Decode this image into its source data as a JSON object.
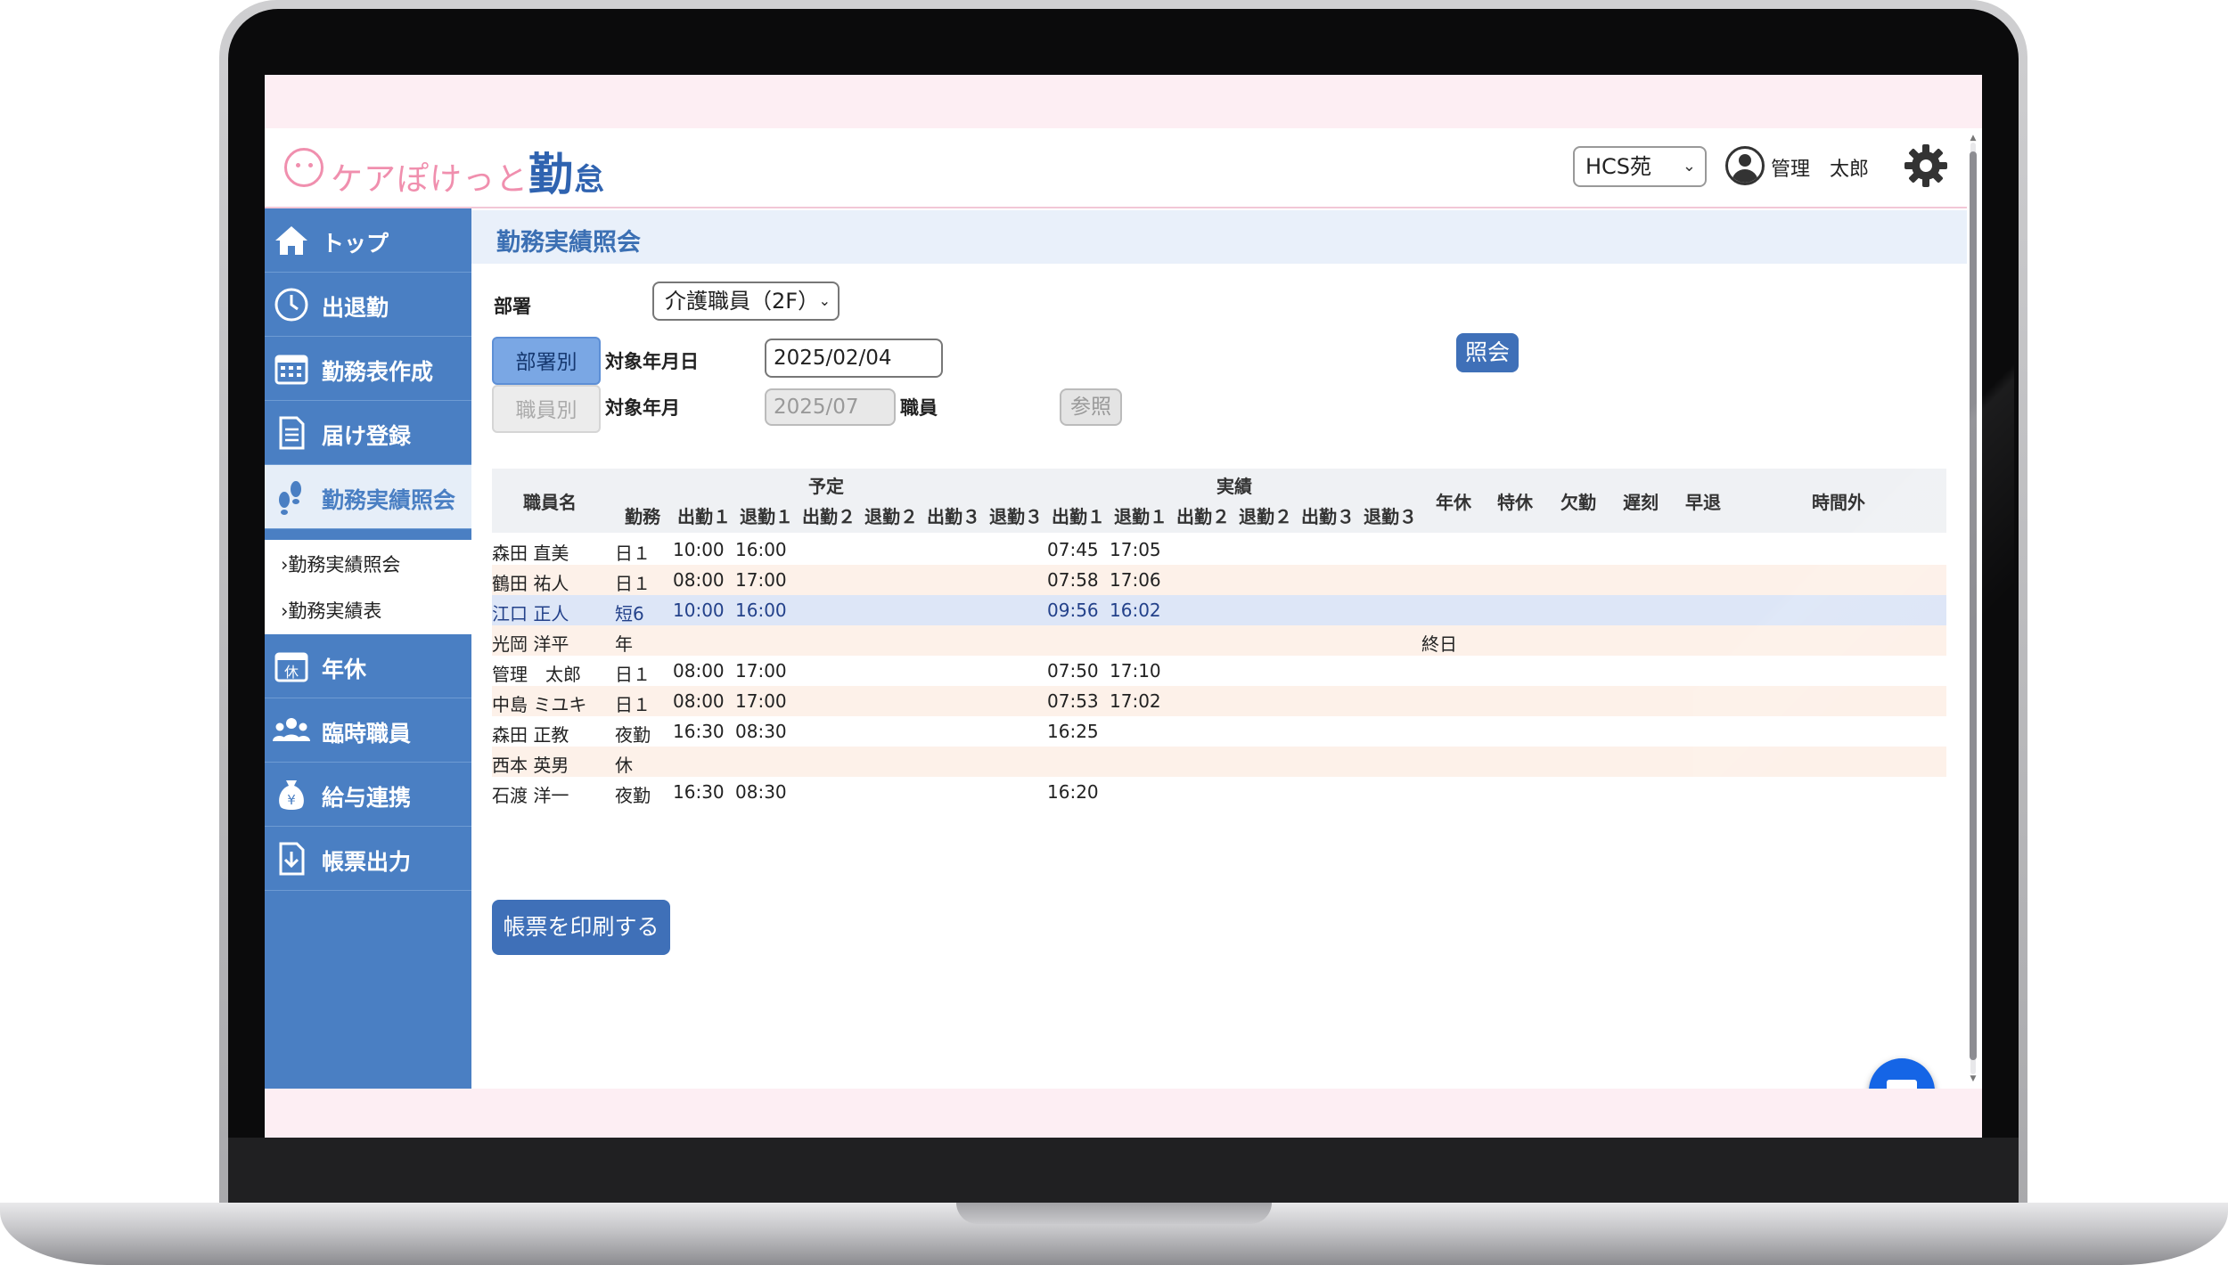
{
  "header": {
    "logo_main": "ケアぽけっと",
    "logo_kin": "勤",
    "logo_tai": "怠",
    "facility": "HCS苑",
    "user": "管理　太郎"
  },
  "sidebar": {
    "items": [
      {
        "label": "トップ",
        "icon": "home-icon"
      },
      {
        "label": "出退勤",
        "icon": "clock-icon"
      },
      {
        "label": "勤務表作成",
        "icon": "calendar-icon"
      },
      {
        "label": "届け登録",
        "icon": "document-icon"
      },
      {
        "label": "勤務実績照会",
        "icon": "footprints-icon"
      },
      {
        "label": "年休",
        "icon": "leave-calendar-icon",
        "badge": "休"
      },
      {
        "label": "臨時職員",
        "icon": "people-icon"
      },
      {
        "label": "給与連携",
        "icon": "yen-bag-icon"
      },
      {
        "label": "帳票出力",
        "icon": "download-doc-icon"
      }
    ],
    "sub_items": [
      "勤務実績照会",
      "勤務実績表"
    ]
  },
  "page": {
    "title": "勤務実績照会",
    "dept_label": "部署",
    "dept_value": "介護職員（2F）",
    "toggle_dept": "部署別",
    "toggle_staff": "職員別",
    "target_date_label": "対象年月日",
    "target_date_value": "2025/02/04",
    "target_month_label": "対象年月",
    "target_month_value": "2025/07",
    "staff_label": "職員",
    "ref_button": "参照",
    "query_button": "照会",
    "print_button": "帳票を印刷する"
  },
  "table": {
    "group_plan": "予定",
    "group_actual": "実績",
    "col_name": "職員名",
    "col_shift": "勤務",
    "plan_cols": [
      "出勤１",
      "退勤１",
      "出勤２",
      "退勤２",
      "出勤３",
      "退勤３"
    ],
    "actual_cols": [
      "出勤１",
      "退勤１",
      "出勤２",
      "退勤２",
      "出勤３",
      "退勤３"
    ],
    "extra_cols": [
      "年休",
      "特休",
      "欠勤",
      "遅刻",
      "早退",
      "時間外"
    ],
    "rows": [
      {
        "name": "森田 直美",
        "shift": "日１",
        "p_in1": "10:00",
        "p_out1": "16:00",
        "a_in1": "07:45",
        "a_out1": "17:05",
        "nenkyu": ""
      },
      {
        "name": "鶴田 祐人",
        "shift": "日１",
        "p_in1": "08:00",
        "p_out1": "17:00",
        "a_in1": "07:58",
        "a_out1": "17:06",
        "nenkyu": ""
      },
      {
        "name": "江口 正人",
        "shift": "短6",
        "p_in1": "10:00",
        "p_out1": "16:00",
        "a_in1": "09:56",
        "a_out1": "16:02",
        "nenkyu": ""
      },
      {
        "name": "光岡 洋平",
        "shift": "年",
        "p_in1": "",
        "p_out1": "",
        "a_in1": "",
        "a_out1": "",
        "nenkyu": "終日"
      },
      {
        "name": "管理　太郎",
        "shift": "日１",
        "p_in1": "08:00",
        "p_out1": "17:00",
        "a_in1": "07:50",
        "a_out1": "17:10",
        "nenkyu": ""
      },
      {
        "name": "中島 ミユキ",
        "shift": "日１",
        "p_in1": "08:00",
        "p_out1": "17:00",
        "a_in1": "07:53",
        "a_out1": "17:02",
        "nenkyu": ""
      },
      {
        "name": "森田 正教",
        "shift": "夜勤",
        "p_in1": "16:30",
        "p_out1": "08:30",
        "a_in1": "16:25",
        "a_out1": "",
        "nenkyu": ""
      },
      {
        "name": "西本 英男",
        "shift": "休",
        "p_in1": "",
        "p_out1": "",
        "a_in1": "",
        "a_out1": "",
        "nenkyu": ""
      },
      {
        "name": "石渡 洋一",
        "shift": "夜勤",
        "p_in1": "16:30",
        "p_out1": "08:30",
        "a_in1": "16:20",
        "a_out1": "",
        "nenkyu": ""
      }
    ]
  },
  "colors": {
    "sidebar": "#4a7fc3",
    "accent_pink": "#f08fae",
    "primary": "#3f70b8",
    "row_alt": "#fdf1e9",
    "row_selected": "#dde6f7"
  }
}
